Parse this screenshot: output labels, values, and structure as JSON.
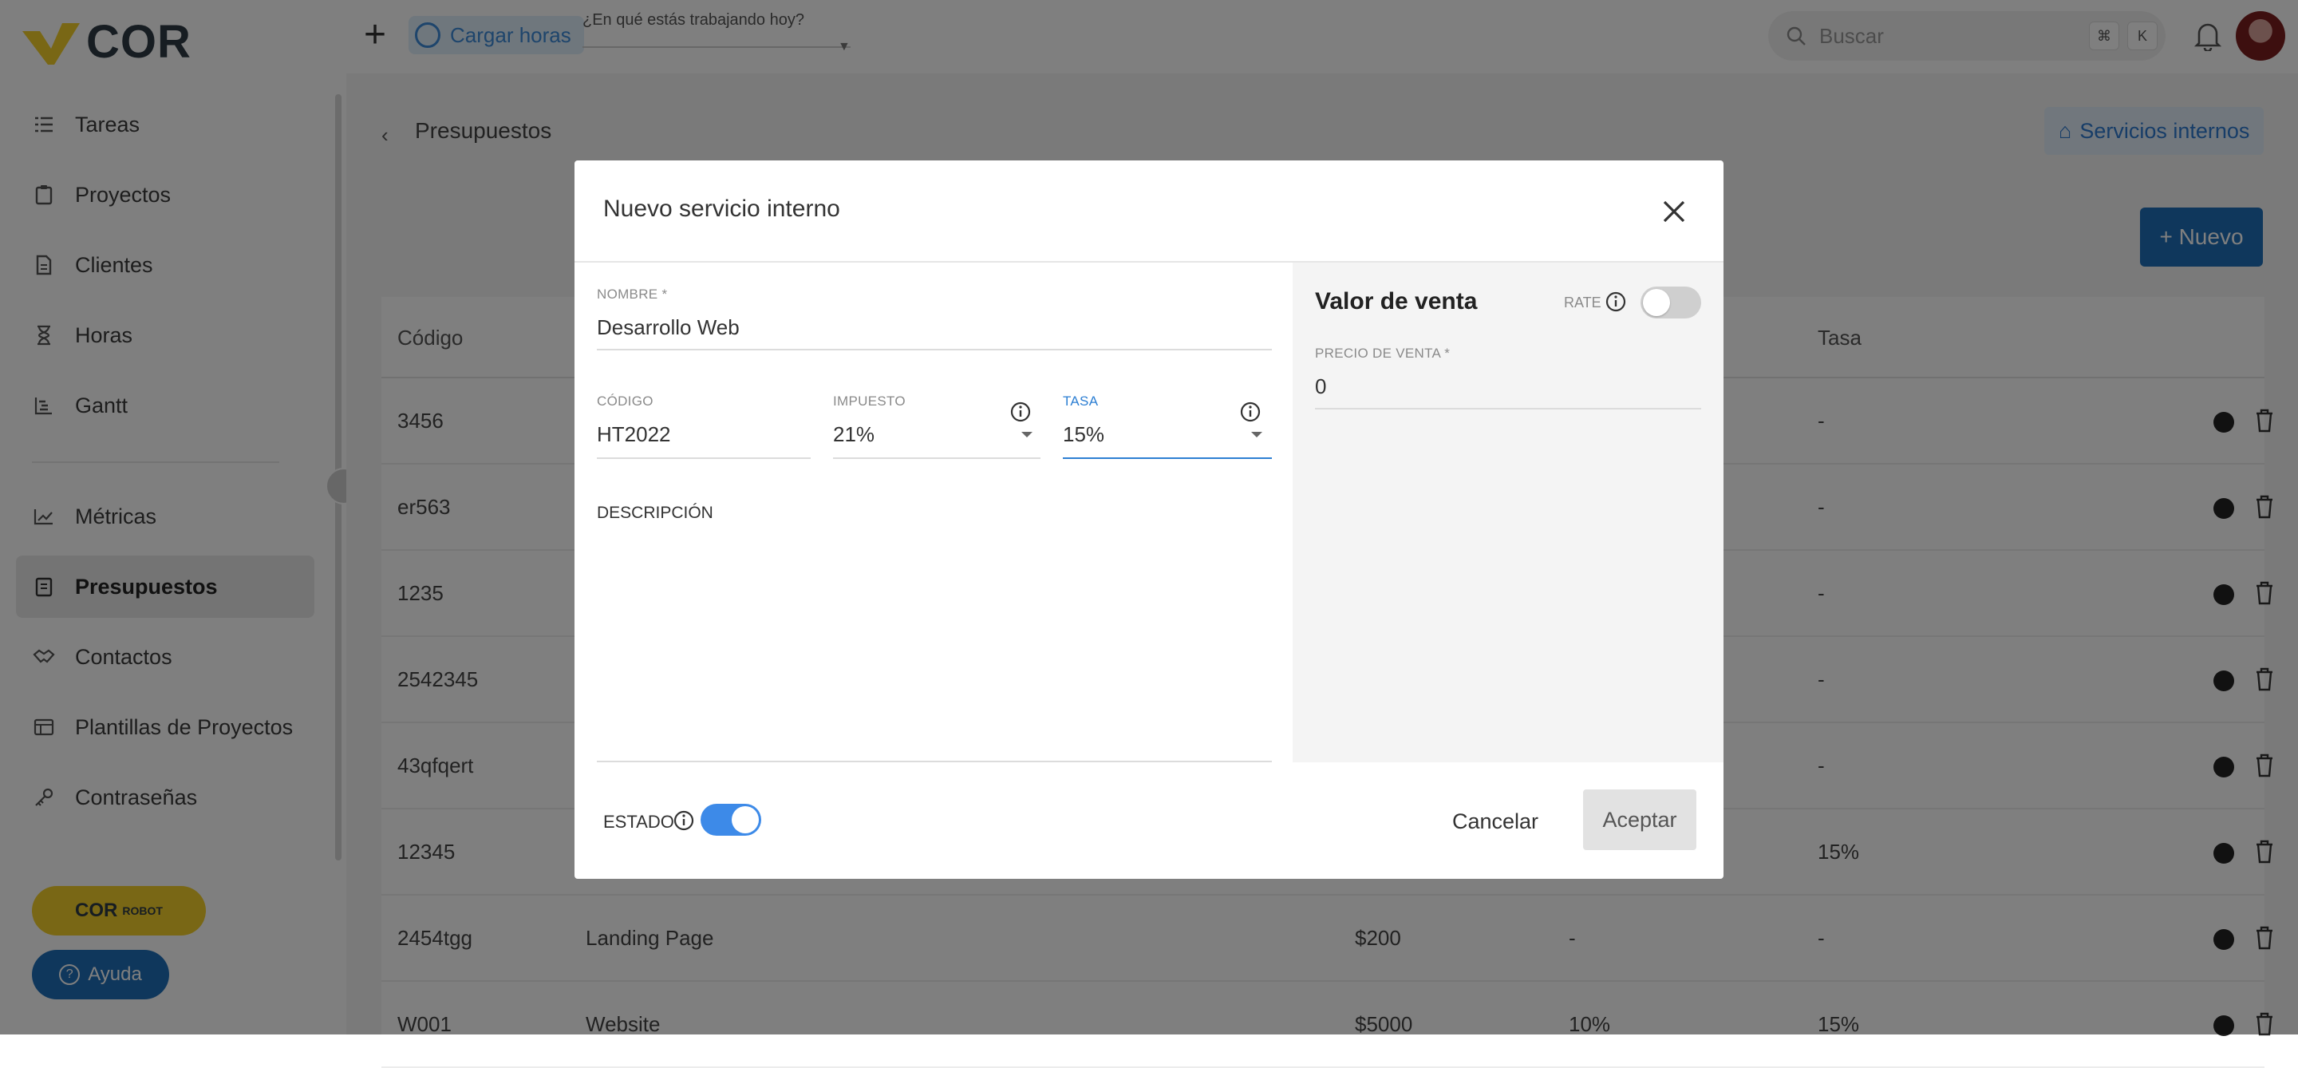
{
  "brand": {
    "name": "COR"
  },
  "sidebar": {
    "items": [
      {
        "label": "Tareas",
        "icon": "list-check-icon"
      },
      {
        "label": "Proyectos",
        "icon": "clipboard-icon"
      },
      {
        "label": "Clientes",
        "icon": "document-icon"
      },
      {
        "label": "Horas",
        "icon": "hourglass-icon"
      },
      {
        "label": "Gantt",
        "icon": "gantt-icon"
      },
      {
        "label": "Métricas",
        "icon": "chart-icon"
      },
      {
        "label": "Presupuestos",
        "icon": "budget-icon",
        "active": true
      },
      {
        "label": "Contactos",
        "icon": "handshake-icon"
      },
      {
        "label": "Plantillas de Proyectos",
        "icon": "template-icon"
      },
      {
        "label": "Contraseñas",
        "icon": "key-icon"
      }
    ],
    "promo_label": "COR",
    "promo_sub": "ROBOT",
    "help_label": "Ayuda"
  },
  "topbar": {
    "load_hours_label": "Cargar horas",
    "working_question": "¿En qué estás trabajando hoy?",
    "search_placeholder": "Buscar",
    "kbd_1": "⌘",
    "kbd_2": "K"
  },
  "page": {
    "breadcrumb": "Presupuestos",
    "active_tab": "Servicios internos",
    "new_button": "+ Nuevo"
  },
  "table": {
    "headers": {
      "code": "Código",
      "rate": "Tasa"
    },
    "rows": [
      {
        "code": "3456",
        "name": "",
        "price": "",
        "tax": "",
        "rate": "-"
      },
      {
        "code": "er563",
        "name": "",
        "price": "",
        "tax": "",
        "rate": "-"
      },
      {
        "code": "1235",
        "name": "",
        "price": "",
        "tax": "",
        "rate": "-"
      },
      {
        "code": "2542345",
        "name": "",
        "price": "",
        "tax": "",
        "rate": "-"
      },
      {
        "code": "43qfqert",
        "name": "",
        "price": "",
        "tax": "",
        "rate": "-"
      },
      {
        "code": "12345",
        "name": "",
        "price": "",
        "tax": "",
        "rate": "15%"
      },
      {
        "code": "2454tgg",
        "name": "Landing Page",
        "price": "$200",
        "tax": "-",
        "rate": "-"
      },
      {
        "code": "W001",
        "name": "Website",
        "price": "$5000",
        "tax": "10%",
        "rate": "15%"
      }
    ]
  },
  "modal": {
    "title": "Nuevo servicio interno",
    "nombre_label": "NOMBRE *",
    "nombre_value": "Desarrollo Web",
    "codigo_label": "CÓDIGO",
    "codigo_value": "HT2022",
    "impuesto_label": "IMPUESTO",
    "impuesto_value": "21%",
    "tasa_label": "TASA",
    "tasa_value": "15%",
    "descripcion_label": "DESCRIPCIÓN",
    "valor_venta_title": "Valor de venta",
    "rate_label": "RATE",
    "rate_enabled": false,
    "precio_label": "PRECIO DE VENTA *",
    "precio_value": "0",
    "estado_label": "ESTADO",
    "estado_enabled": true,
    "cancel_label": "Cancelar",
    "accept_label": "Aceptar"
  },
  "colors": {
    "accent": "#3d8ae8",
    "brand_yellow": "#f3cf2a",
    "primary_blue": "#1f6fb8"
  }
}
